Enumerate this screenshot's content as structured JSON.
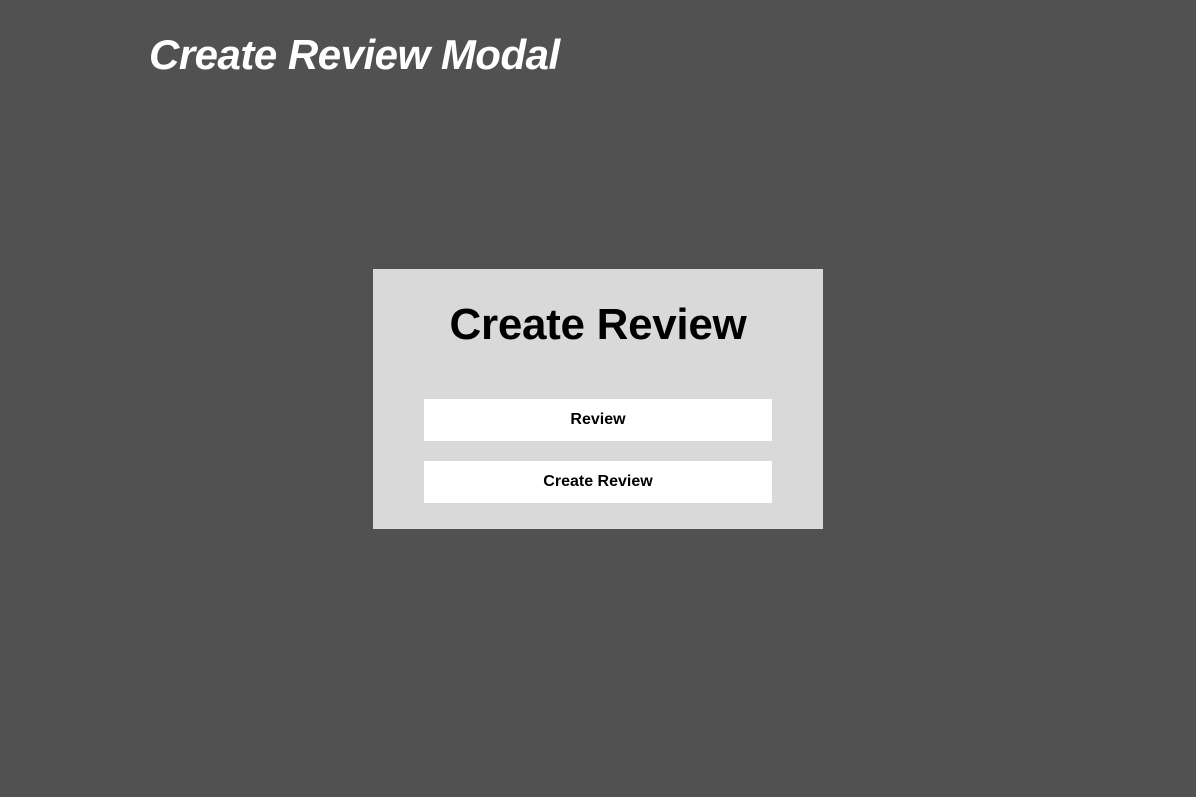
{
  "page": {
    "title": "Create Review Modal",
    "background_color": "#515151"
  },
  "modal": {
    "title": "Create Review",
    "background_color": "#d9d9d9",
    "review_field": {
      "label": "Review"
    },
    "submit_button": {
      "label": "Create Review"
    }
  }
}
